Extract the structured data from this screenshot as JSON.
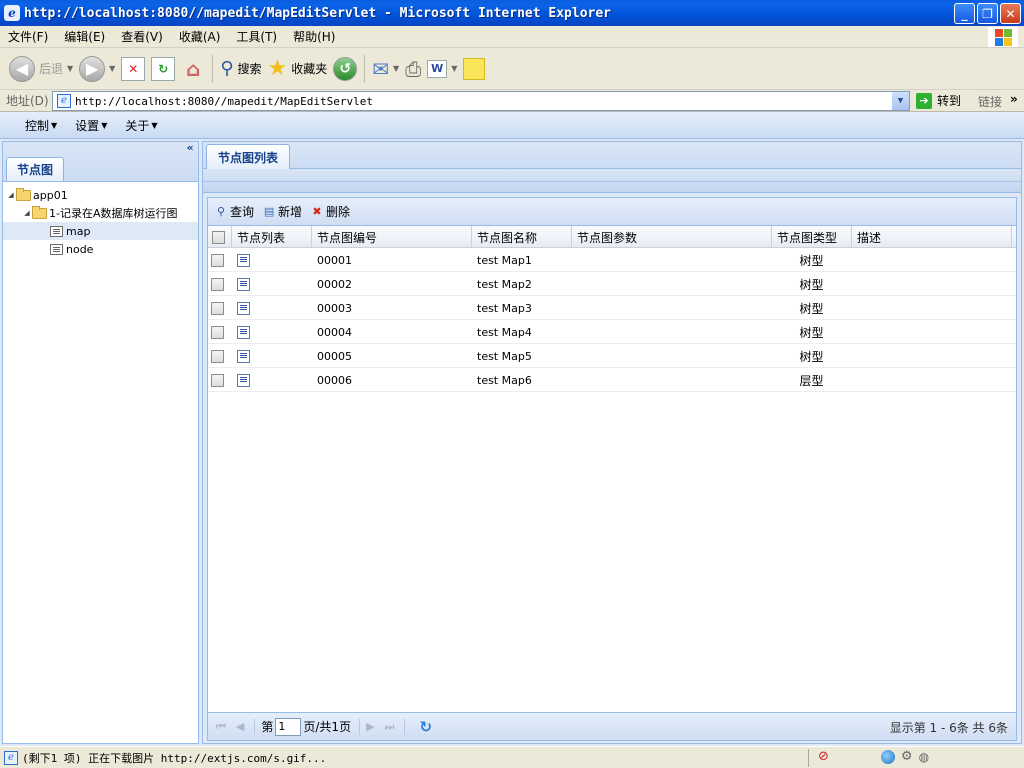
{
  "window": {
    "title": "http://localhost:8080//mapedit/MapEditServlet - Microsoft Internet Explorer",
    "minimize": "_",
    "maximize": "❐",
    "close": "✕"
  },
  "menubar": {
    "items": [
      "文件(F)",
      "编辑(E)",
      "查看(V)",
      "收藏(A)",
      "工具(T)",
      "帮助(H)"
    ]
  },
  "toolbar": {
    "back_label": "后退",
    "search_label": "搜索",
    "favorites_label": "收藏夹"
  },
  "addressbar": {
    "label": "地址(D)",
    "url": "http://localhost:8080//mapedit/MapEditServlet",
    "go_label": "转到",
    "links_label": "链接",
    "more": "»"
  },
  "app_toolbar": {
    "items": [
      "控制",
      "设置",
      "关于"
    ]
  },
  "west_panel": {
    "collapse": "«",
    "tab": "节点图",
    "tree": {
      "root": "app01",
      "child": "1-记录在A数据库树运行图",
      "leaves": [
        "map",
        "node"
      ]
    }
  },
  "center_panel": {
    "tab": "节点图列表",
    "grid_toolbar": {
      "search": "查询",
      "add": "新增",
      "delete": "删除"
    },
    "columns": [
      "节点列表",
      "节点图编号",
      "节点图名称",
      "节点图参数",
      "节点图类型",
      "描述"
    ],
    "rows": [
      {
        "id": "00001",
        "name": "test Map1",
        "params": "",
        "type": "树型",
        "desc": ""
      },
      {
        "id": "00002",
        "name": "test Map2",
        "params": "",
        "type": "树型",
        "desc": ""
      },
      {
        "id": "00003",
        "name": "test Map3",
        "params": "",
        "type": "树型",
        "desc": ""
      },
      {
        "id": "00004",
        "name": "test Map4",
        "params": "",
        "type": "树型",
        "desc": ""
      },
      {
        "id": "00005",
        "name": "test Map5",
        "params": "",
        "type": "树型",
        "desc": ""
      },
      {
        "id": "00006",
        "name": "test Map6",
        "params": "",
        "type": "层型",
        "desc": ""
      }
    ],
    "pager": {
      "page_prefix": "第",
      "page_value": "1",
      "page_suffix": "页/共1页",
      "info": "显示第 1 - 6条 共 6条"
    }
  },
  "statusbar": {
    "text": "(剩下1 项) 正在下载图片 http://extjs.com/s.gif..."
  }
}
